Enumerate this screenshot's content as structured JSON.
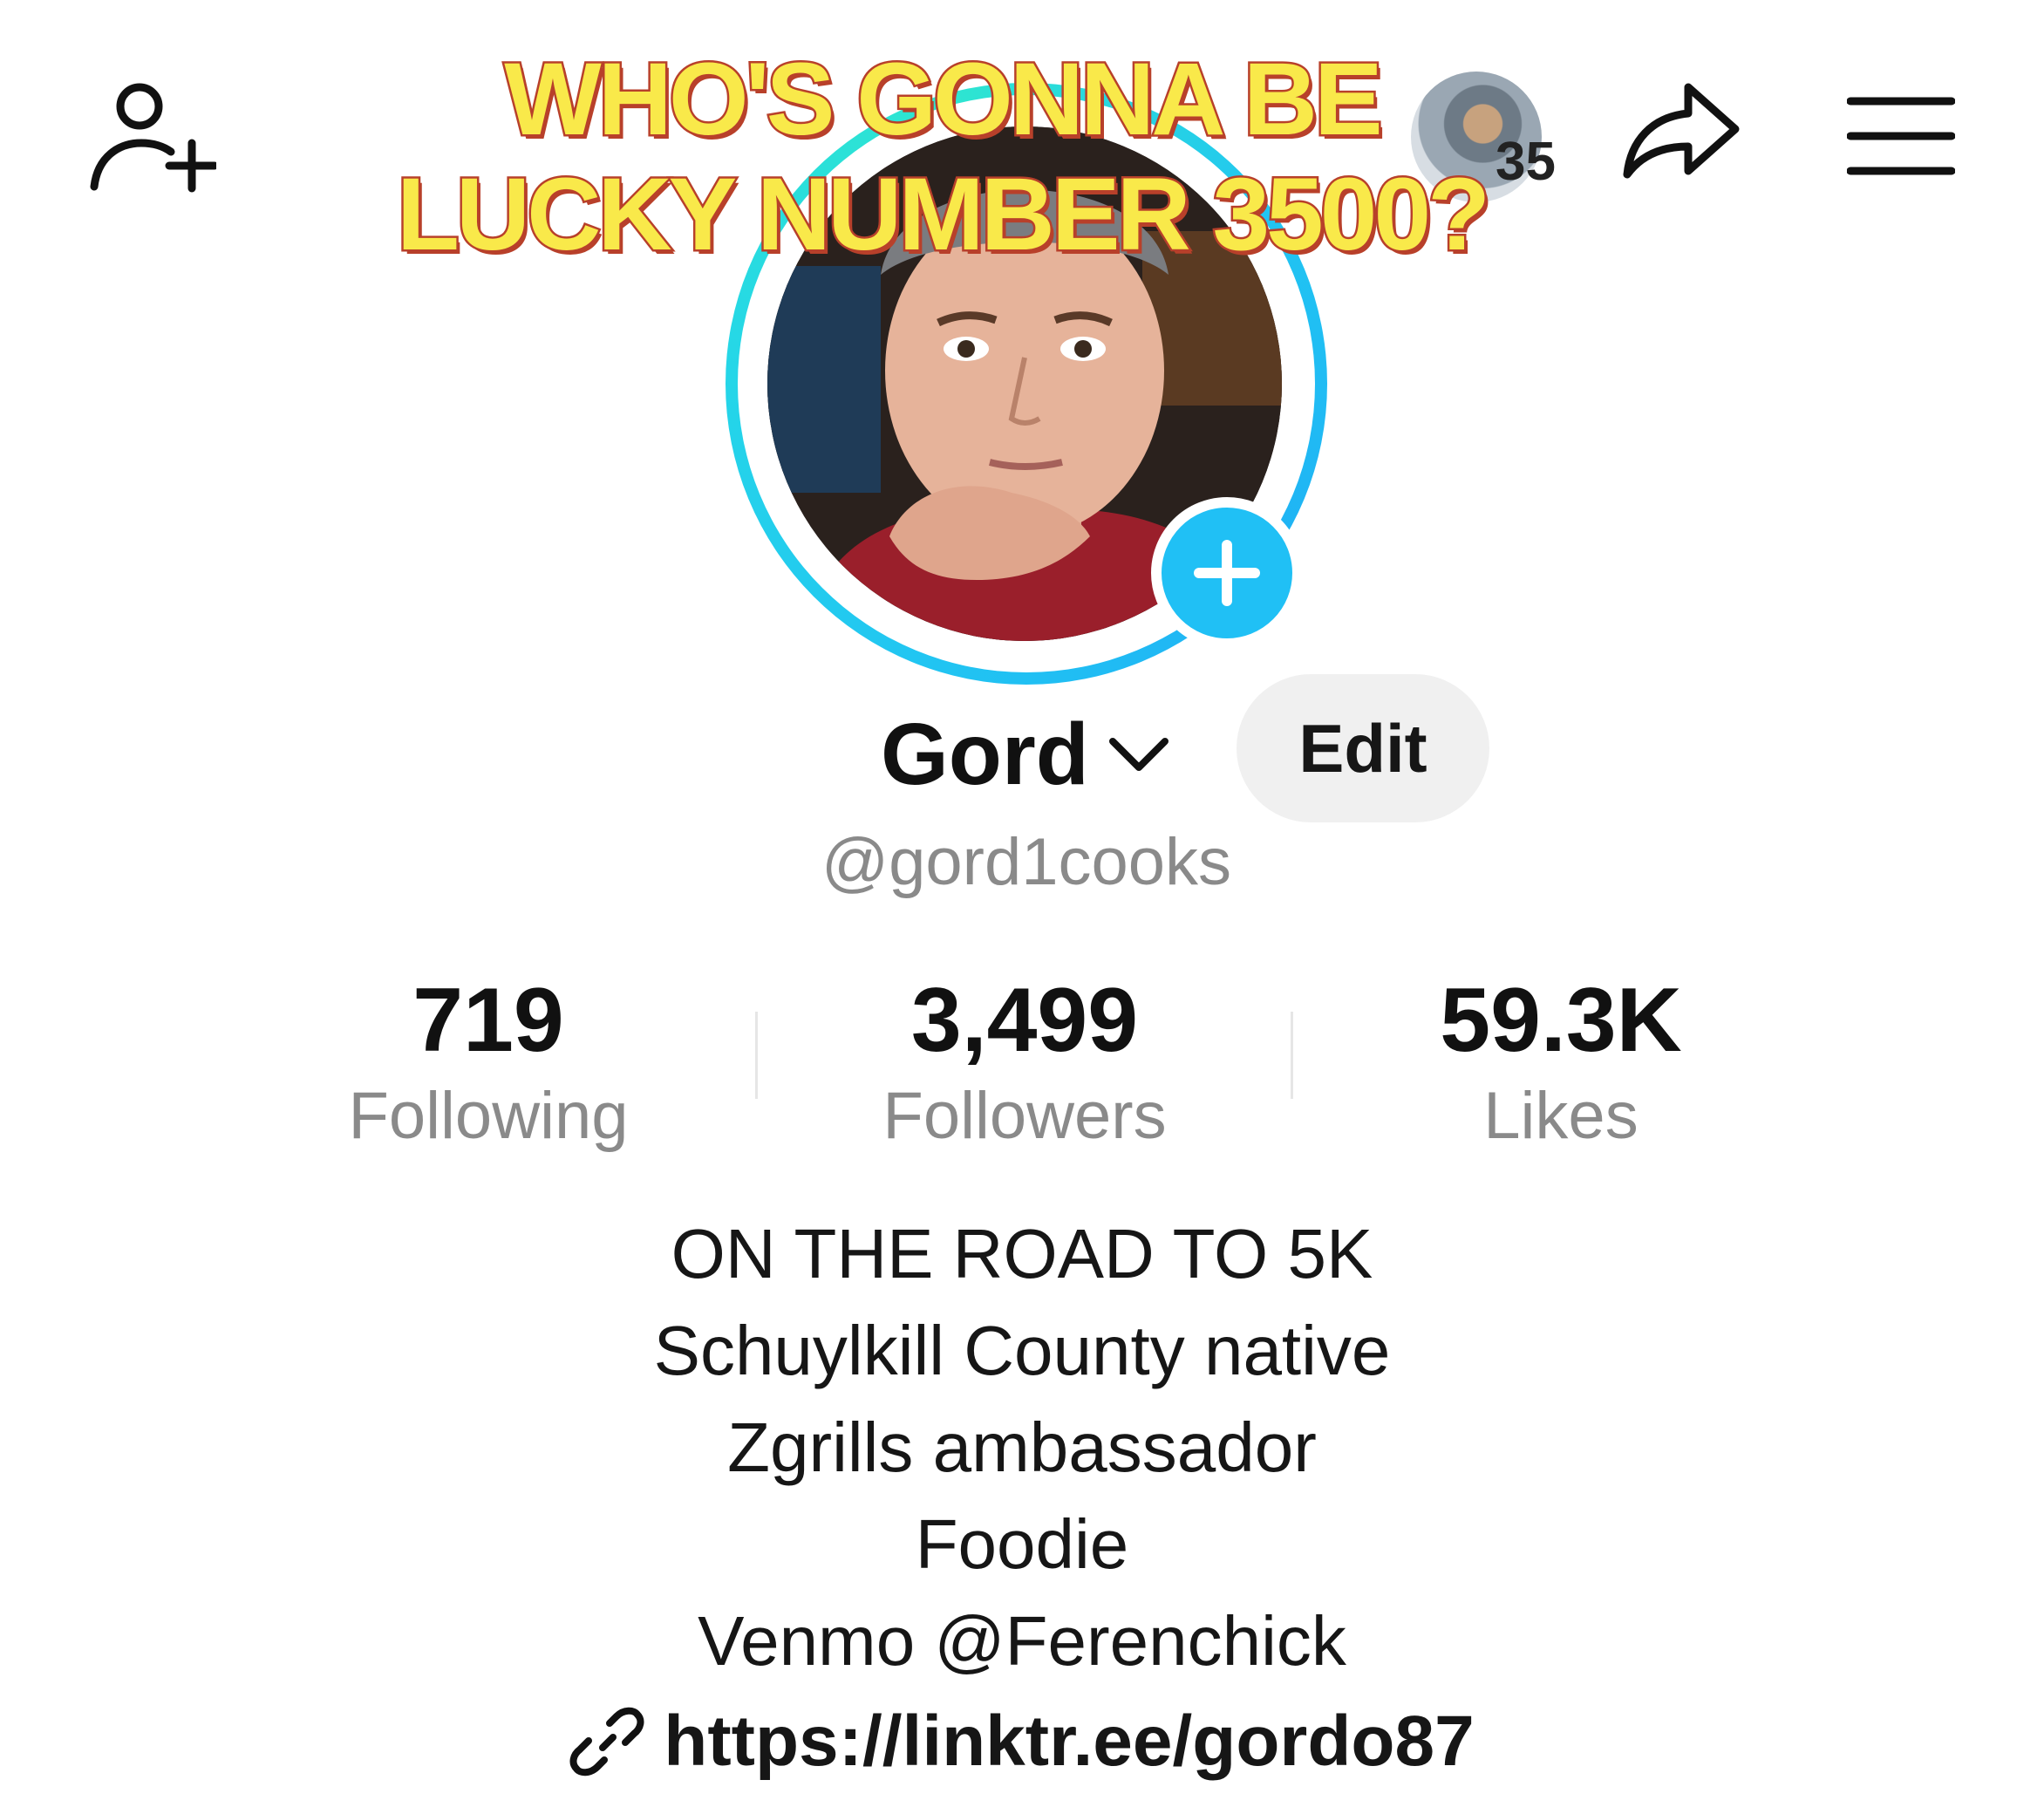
{
  "overlay": {
    "caption_line1": "WHO'S GONNA BE",
    "caption_line2": "LUCKY NUMBER 3500?"
  },
  "topbar": {
    "add_friend_icon": "person-plus-icon",
    "share_icon": "share-arrow-icon",
    "menu_icon": "hamburger-menu-icon",
    "visitor_count": "35"
  },
  "profile": {
    "display_name": "Gord",
    "edit_label": "Edit",
    "username": "@gord1cooks"
  },
  "stats": [
    {
      "value": "719",
      "label": "Following"
    },
    {
      "value": "3,499",
      "label": "Followers"
    },
    {
      "value": "59.3K",
      "label": "Likes"
    }
  ],
  "bio": {
    "lines": [
      "ON THE ROAD TO 5K",
      "Schuylkill County native",
      "Zgrills ambassador",
      "Foodie",
      "Venmo @Ferenchick"
    ],
    "link": "https://linktr.ee/gordo87"
  },
  "colors": {
    "ring": "#21c5f2",
    "add_button": "#20c0f5",
    "caption_fill": "#f9e94a",
    "caption_outline": "#b8402a",
    "secondary_text": "#8a8a8a"
  }
}
